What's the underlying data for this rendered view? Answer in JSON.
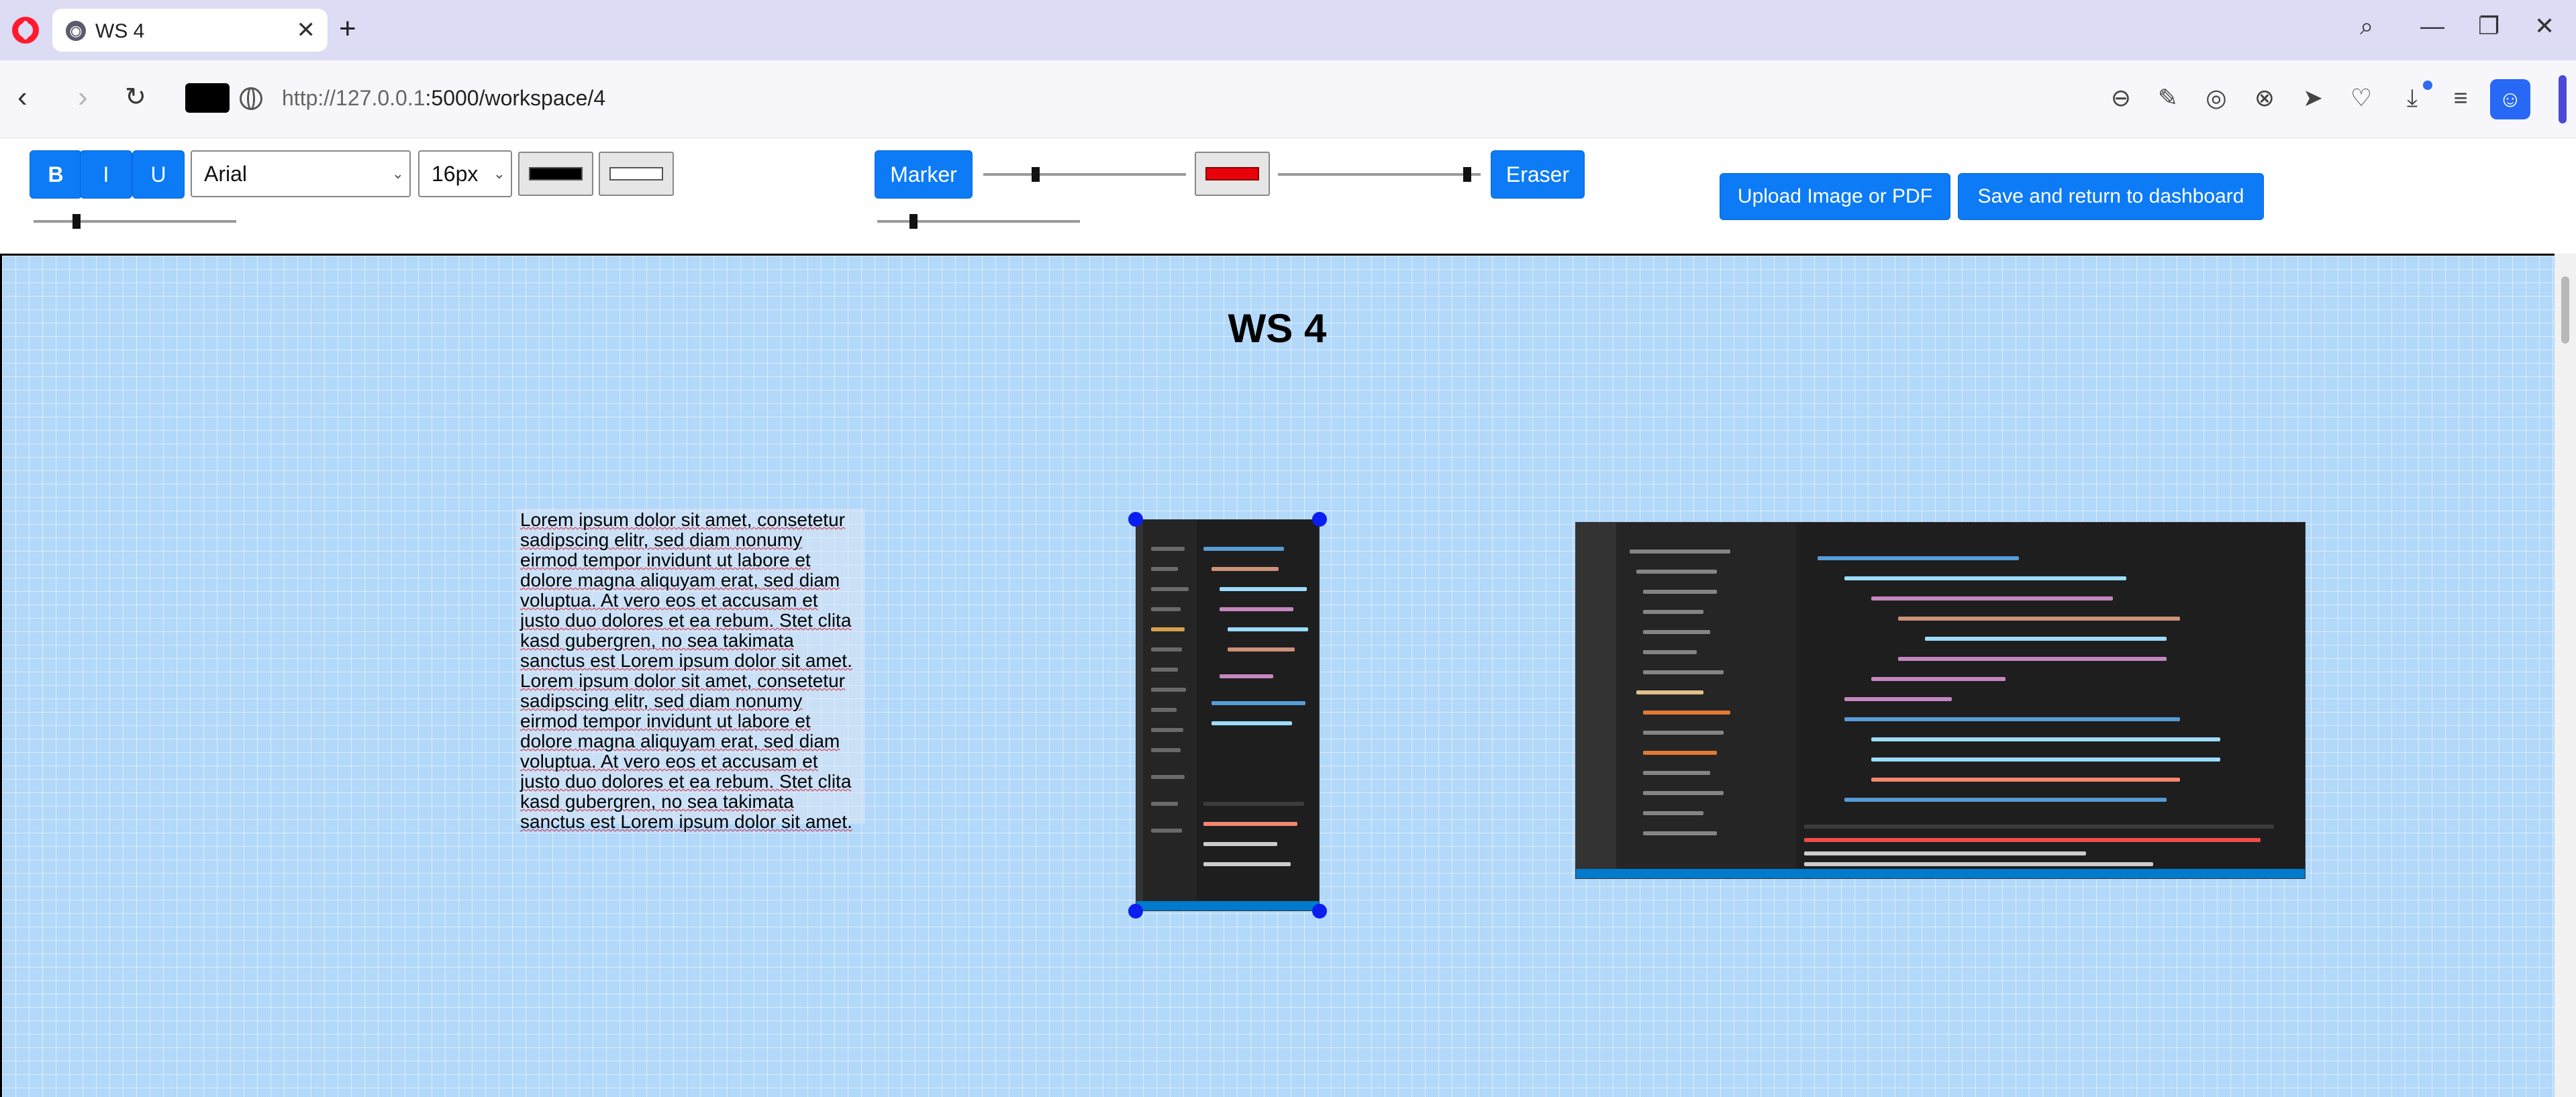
{
  "browser": {
    "tab_title": "WS 4",
    "tab_close": "✕",
    "new_tab": "+",
    "url_host": "http://127.0.0.1",
    "url_path": ":5000/workspace/4"
  },
  "toolbar": {
    "bold_label": "B",
    "italic_label": "I",
    "underline_label": "U",
    "font_family": "Arial",
    "font_size": "16px",
    "text_color": "#000000",
    "text_bg_color": "#ffffff",
    "marker_label": "Marker",
    "marker_color": "#e8000b",
    "eraser_label": "Eraser",
    "upload_label": "Upload Image or PDF",
    "save_label": "Save and return to dashboard"
  },
  "workspace": {
    "title": "WS 4",
    "text_block": "Lorem ipsum dolor sit amet, consetetur sadipscing elitr, sed diam nonumy eirmod tempor invidunt ut labore et dolore magna aliquyam erat, sed diam voluptua. At vero eos et accusam et justo duo dolores et ea rebum. Stet clita kasd gubergren, no sea takimata sanctus est Lorem ipsum dolor sit amet. Lorem ipsum dolor sit amet, consetetur sadipscing elitr, sed diam nonumy eirmod tempor invidunt ut labore et dolore magna aliquyam erat, sed diam voluptua. At vero eos et accusam et justo duo dolores et ea rebum. Stet clita kasd gubergren, no sea takimata sanctus est Lorem ipsum dolor sit amet."
  },
  "colors": {
    "accent": "#0c7bf5",
    "canvas_bg": "#b2d8fa",
    "handle": "#0b1ef0"
  }
}
